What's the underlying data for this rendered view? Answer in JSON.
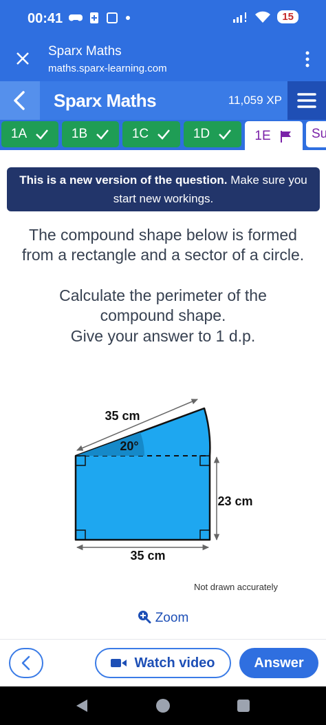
{
  "status": {
    "time": "00:41",
    "battery": "15"
  },
  "browser": {
    "title": "Sparx Maths",
    "url": "maths.sparx-learning.com"
  },
  "app": {
    "title": "Sparx Maths",
    "xp": "11,059 XP"
  },
  "tabs": [
    {
      "label": "1A",
      "state": "done"
    },
    {
      "label": "1B",
      "state": "done"
    },
    {
      "label": "1C",
      "state": "done"
    },
    {
      "label": "1D",
      "state": "done"
    },
    {
      "label": "1E",
      "state": "active"
    },
    {
      "label": "Su",
      "state": "partial"
    }
  ],
  "notice": {
    "bold": "This is a new version of the question.",
    "rest": " Make sure you start new workings."
  },
  "question": {
    "line1": "The compound shape below is formed",
    "line2": "from a rectangle and a sector of a circle.",
    "line3": "Calculate the perimeter of the",
    "line4": "compound shape.",
    "line5": "Give your answer to 1 d.p."
  },
  "diagram": {
    "radius_label": "35 cm",
    "angle_label": "20°",
    "height_label": "23 cm",
    "width_label": "35 cm",
    "note": "Not drawn accurately",
    "fill_color": "#1ea7f0"
  },
  "zoom_label": "Zoom",
  "buttons": {
    "video": "Watch video",
    "answer": "Answer"
  },
  "colors": {
    "primary": "#2f6fe0",
    "tab_done": "#1f9d55",
    "active_tab_text": "#7a22a8",
    "notice_bg": "#22356a"
  }
}
